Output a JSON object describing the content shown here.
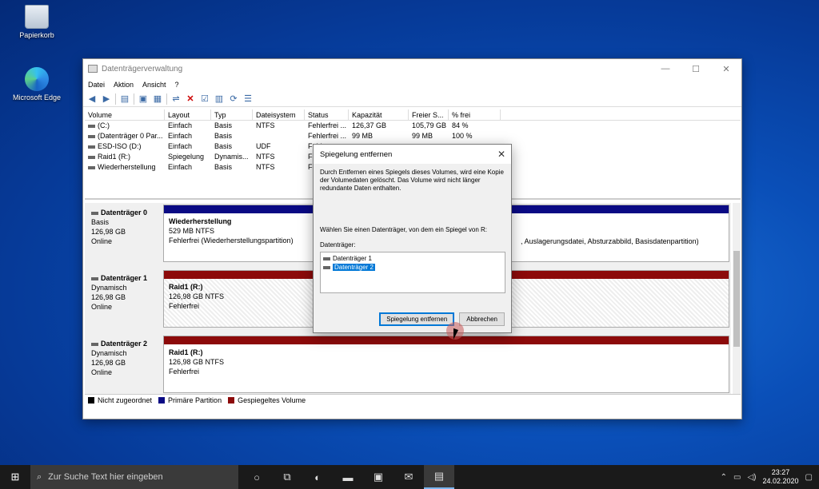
{
  "desktop": {
    "icons": [
      {
        "label": "Papierkorb"
      },
      {
        "label": "Microsoft Edge"
      }
    ]
  },
  "window": {
    "title": "Datenträgerverwaltung",
    "controls": {
      "minimize": "—",
      "maximize": "☐",
      "close": "✕"
    },
    "menu": [
      "Datei",
      "Aktion",
      "Ansicht",
      "?"
    ],
    "columns": [
      "Volume",
      "Layout",
      "Typ",
      "Dateisystem",
      "Status",
      "Kapazität",
      "Freier S...",
      "% frei"
    ],
    "volumes": [
      [
        "(C:)",
        "Einfach",
        "Basis",
        "NTFS",
        "Fehlerfrei ...",
        "126,37 GB",
        "105,79 GB",
        "84 %"
      ],
      [
        "(Datenträger 0 Par...",
        "Einfach",
        "Basis",
        "",
        "Fehlerfrei ...",
        "99 MB",
        "99 MB",
        "100 %"
      ],
      [
        "ESD-ISO (D:)",
        "Einfach",
        "Basis",
        "UDF",
        "Fehl",
        "",
        "",
        ""
      ],
      [
        "Raid1 (R:)",
        "Spiegelung",
        "Dynamis...",
        "NTFS",
        "Fehl",
        "",
        "",
        ""
      ],
      [
        "Wiederherstellung",
        "Einfach",
        "Basis",
        "NTFS",
        "Fehl",
        "",
        "",
        ""
      ]
    ],
    "disks": [
      {
        "name": "Datenträger 0",
        "type": "Basis",
        "size": "126,98 GB",
        "state": "Online",
        "part_name": "Wiederherstellung",
        "part_size": "529 MB NTFS",
        "part_status": "Fehlerfrei (Wiederherstellungspartition)",
        "part_extra": ", Auslagerungsdatei, Absturzabbild, Basisdatenpartition)"
      },
      {
        "name": "Datenträger 1",
        "type": "Dynamisch",
        "size": "126,98 GB",
        "state": "Online",
        "part_name": "Raid1  (R:)",
        "part_size": "126,98 GB NTFS",
        "part_status": "Fehlerfrei"
      },
      {
        "name": "Datenträger 2",
        "type": "Dynamisch",
        "size": "126,98 GB",
        "state": "Online",
        "part_name": "Raid1  (R:)",
        "part_size": "126,98 GB NTFS",
        "part_status": "Fehlerfrei"
      }
    ],
    "legend": [
      {
        "label": "Nicht zugeordnet",
        "color": "#000000"
      },
      {
        "label": "Primäre Partition",
        "color": "#0a0a84"
      },
      {
        "label": "Gespiegeltes Volume",
        "color": "#8c0a0a"
      }
    ]
  },
  "dialog": {
    "title": "Spiegelung entfernen",
    "description": "Durch Entfernen eines Spiegels dieses Volumes, wird eine Kopie der Volumedaten gelöscht. Das Volume wird nicht länger redundante Daten enthalten.",
    "prompt": "Wählen Sie einen Datenträger, von dem ein Spiegel von R:",
    "list_label": "Datenträger:",
    "items": [
      "Datenträger 1",
      "Datenträger 2"
    ],
    "selected_index": 1,
    "ok_label": "Spiegelung entfernen",
    "cancel_label": "Abbrechen"
  },
  "taskbar": {
    "search_placeholder": "Zur Suche Text hier eingeben",
    "time": "23:27",
    "date": "24.02.2020"
  }
}
